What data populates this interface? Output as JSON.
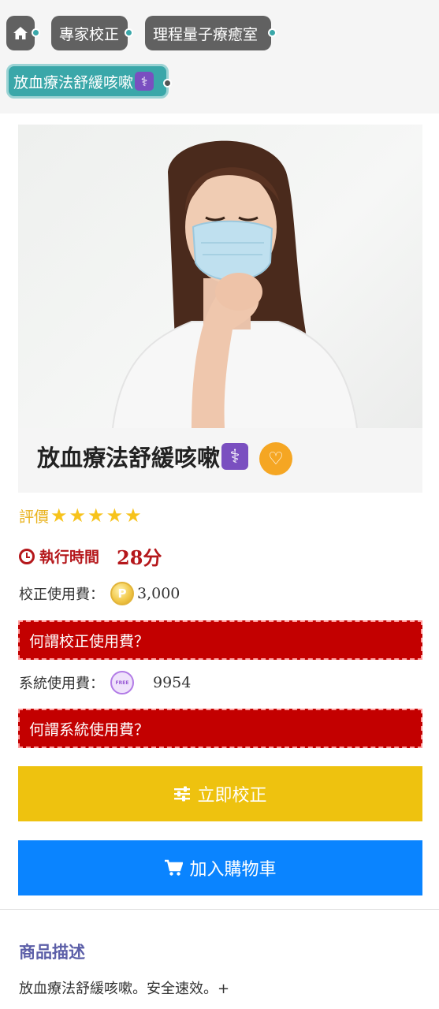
{
  "breadcrumb": {
    "home_icon": "home-icon",
    "items": [
      {
        "label": "專家校正"
      },
      {
        "label": "理程量子療癒室"
      }
    ],
    "active": {
      "label": "放血療法舒緩咳嗽",
      "badge_icon": "medical-symbol-icon",
      "badge_glyph": "⚕"
    }
  },
  "product": {
    "title": "放血療法舒緩咳嗽",
    "title_badge_glyph": "⚕",
    "favorite_icon": "heart-minus-icon",
    "favorite_glyph": "♡"
  },
  "rating": {
    "label": "評價",
    "stars": 5,
    "max": 5
  },
  "runtime": {
    "label": "執行時間",
    "value": "28分"
  },
  "correction_fee": {
    "label": "校正使用費：",
    "coin_letter": "P",
    "value": "3,000",
    "help": "何謂校正使用費？"
  },
  "system_fee": {
    "label": "系統使用費：",
    "coin_text": "FREE",
    "value": "9954",
    "help": "何謂系統使用費？"
  },
  "buttons": {
    "correct_now": "立即校正",
    "add_to_cart": "加入購物車"
  },
  "description": {
    "heading": "商品描述",
    "text": "放血療法舒緩咳嗽。安全速效。+"
  },
  "colors": {
    "accent_teal": "#3aa7a9",
    "fee_red": "#c30000",
    "button_yellow": "#eec20f",
    "button_blue": "#0a84ff",
    "heading_purple": "#5c5fa8"
  }
}
